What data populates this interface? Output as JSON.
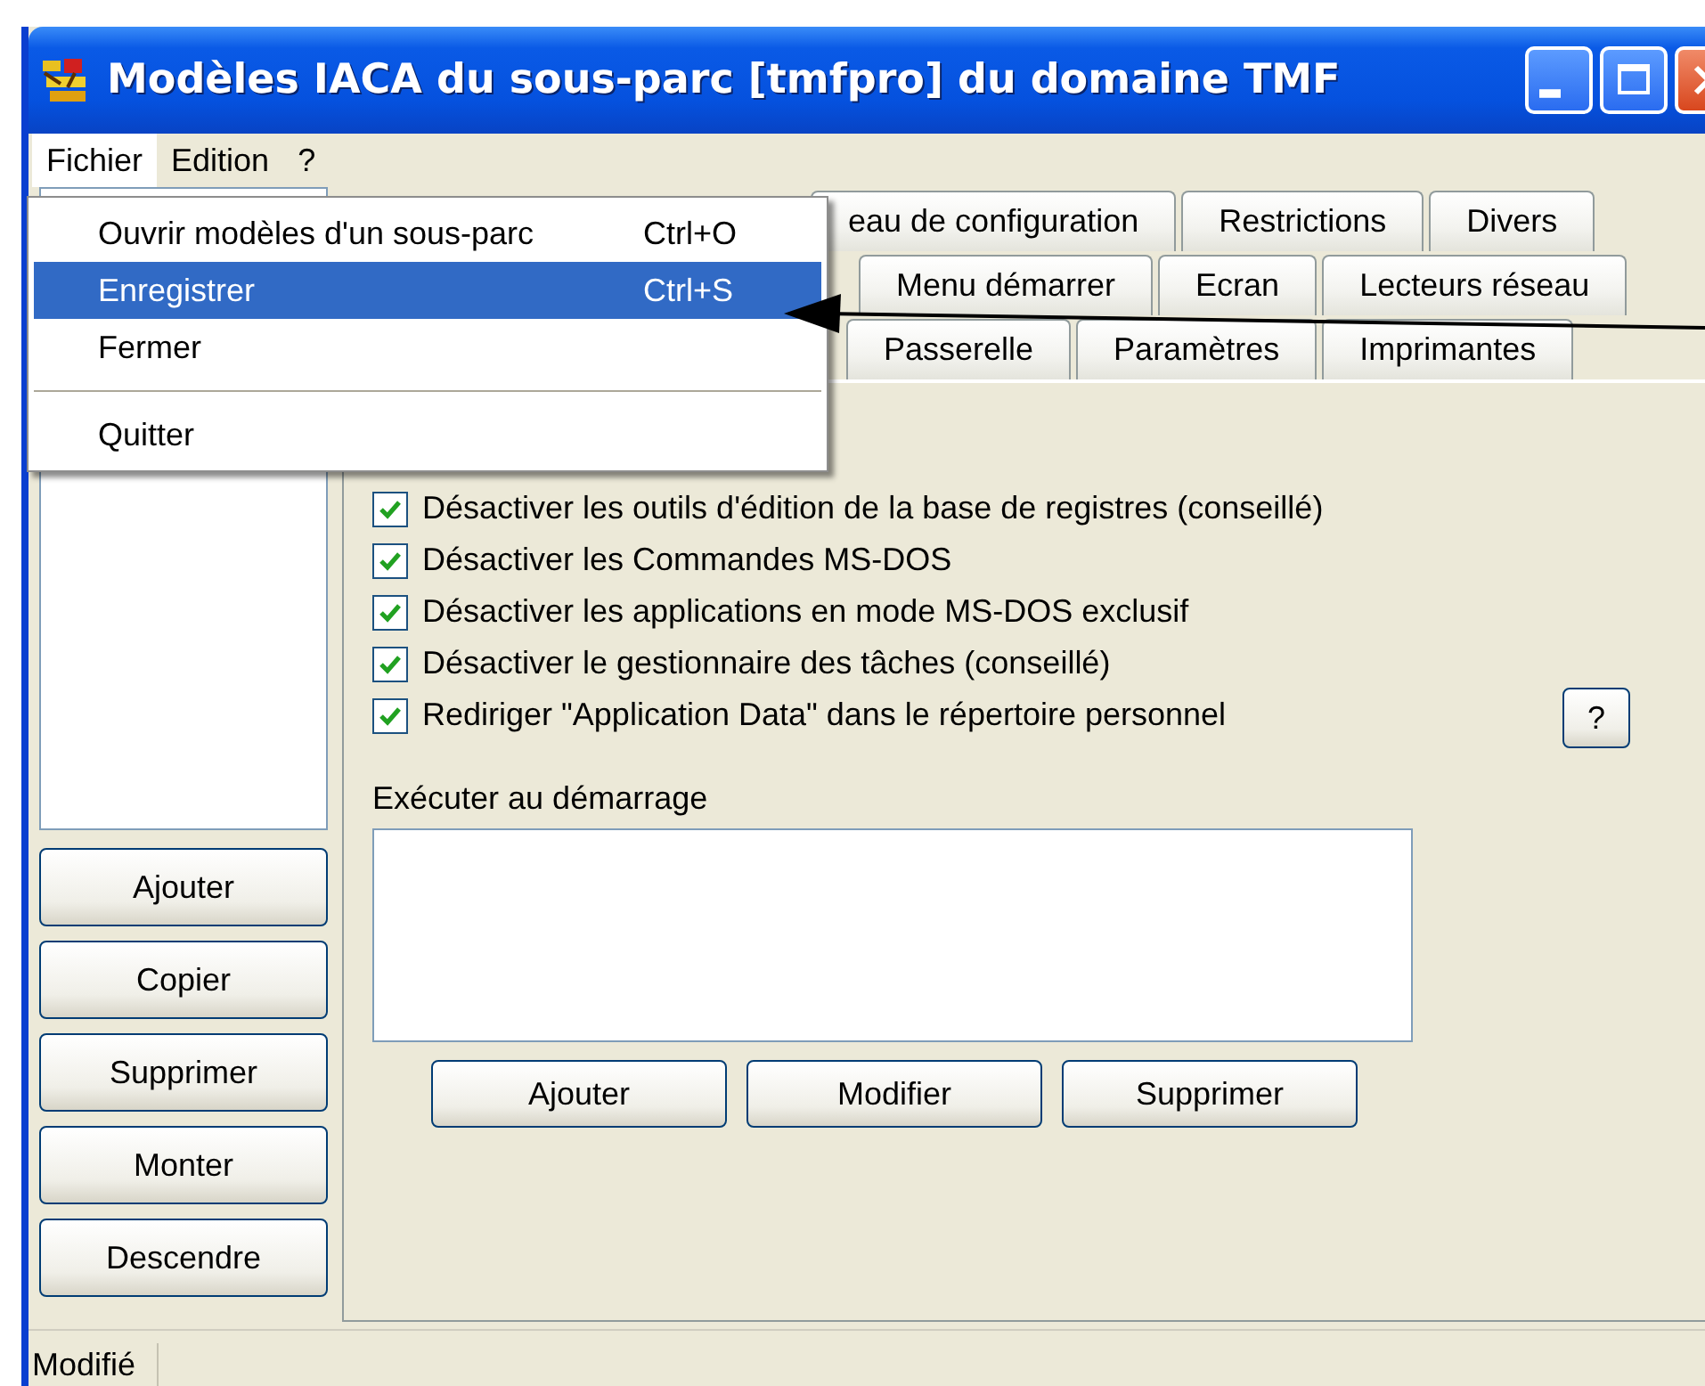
{
  "window": {
    "title": "Modèles IACA du sous-parc [tmfpro] du domaine TMF"
  },
  "menubar": [
    {
      "label": "Fichier",
      "selected": true
    },
    {
      "label": "Edition",
      "selected": false
    },
    {
      "label": "?",
      "selected": false
    }
  ],
  "file_menu": [
    {
      "kind": "item",
      "label": "Ouvrir modèles d'un sous-parc",
      "shortcut": "Ctrl+O",
      "selected": false
    },
    {
      "kind": "item",
      "label": "Enregistrer",
      "shortcut": "Ctrl+S",
      "selected": true
    },
    {
      "kind": "item",
      "label": "Fermer",
      "selected": false
    },
    {
      "kind": "separator"
    },
    {
      "kind": "item",
      "label": "Quitter",
      "selected": false
    }
  ],
  "left_buttons": [
    "Ajouter",
    "Copier",
    "Supprimer",
    "Monter",
    "Descendre"
  ],
  "tab_rows": [
    [
      {
        "label": "eau de configuration",
        "selected": false
      },
      {
        "label": "Restrictions",
        "selected": false
      },
      {
        "label": "Divers",
        "selected": false
      }
    ],
    [
      {
        "label": "Menu démarrer",
        "selected": false
      },
      {
        "label": "Ecran",
        "selected": false
      },
      {
        "label": "Lecteurs réseau",
        "selected": false
      }
    ],
    [
      {
        "label": "Passerelle",
        "selected": false
      },
      {
        "label": "Paramètres",
        "selected": false
      },
      {
        "label": "Imprimantes",
        "selected": false
      }
    ]
  ],
  "options": [
    {
      "label": "Désactiver les outils d'édition de la base de registres (conseillé)",
      "checked": true
    },
    {
      "label": "Désactiver les Commandes MS-DOS",
      "checked": true
    },
    {
      "label": "Désactiver les applications en mode MS-DOS exclusif",
      "checked": true
    },
    {
      "label": "Désactiver le gestionnaire des tâches (conseillé)",
      "checked": true
    },
    {
      "label": "Rediriger \"Application Data\" dans le répertoire personnel",
      "checked": true
    }
  ],
  "help_button": "?",
  "startup": {
    "label": "Exécuter au démarrage",
    "buttons": [
      "Ajouter",
      "Modifier",
      "Supprimer"
    ]
  },
  "status_bar": {
    "text": "Modifié"
  }
}
